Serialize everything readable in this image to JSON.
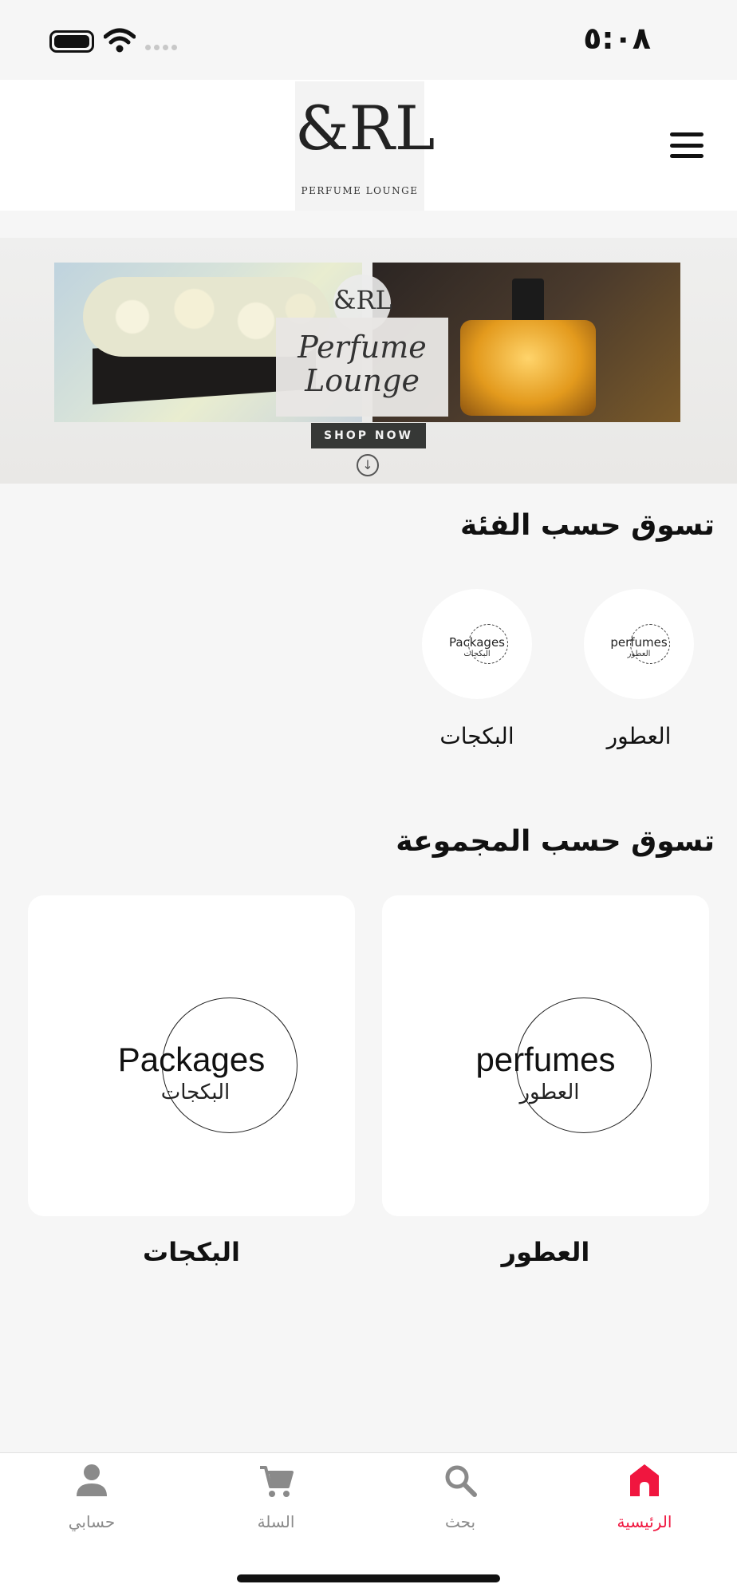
{
  "status_bar": {
    "time": "٥:٠٨"
  },
  "header": {
    "logo_mark": "&RL",
    "logo_text": "PERFUME LOUNGE",
    "menu_icon": "hamburger-icon"
  },
  "banner": {
    "emblem": "&RL",
    "title_line1": "Perfume",
    "title_line2": "Lounge",
    "cta": "SHOP NOW",
    "arrow": "↓"
  },
  "categories_section": {
    "title": "تسوق حسب الفئة",
    "items": [
      {
        "label": "العطور",
        "image_en": "perfumes",
        "image_ar": "العطور"
      },
      {
        "label": "البكجات",
        "image_en": "Packages",
        "image_ar": "البكجات"
      }
    ]
  },
  "collections_section": {
    "title": "تسوق حسب المجموعة",
    "items": [
      {
        "label": "العطور",
        "image_en": "perfumes",
        "image_ar": "العطور"
      },
      {
        "label": "البكجات",
        "image_en": "Packages",
        "image_ar": "البكجات"
      }
    ]
  },
  "bottom_nav": {
    "active_color": "#f0163f",
    "inactive_color": "#8a8a8a",
    "items": [
      {
        "label": "الرئيسية",
        "icon": "home-icon",
        "active": true
      },
      {
        "label": "بحث",
        "icon": "search-icon",
        "active": false
      },
      {
        "label": "السلة",
        "icon": "cart-icon",
        "active": false
      },
      {
        "label": "حسابي",
        "icon": "user-icon",
        "active": false
      }
    ]
  }
}
